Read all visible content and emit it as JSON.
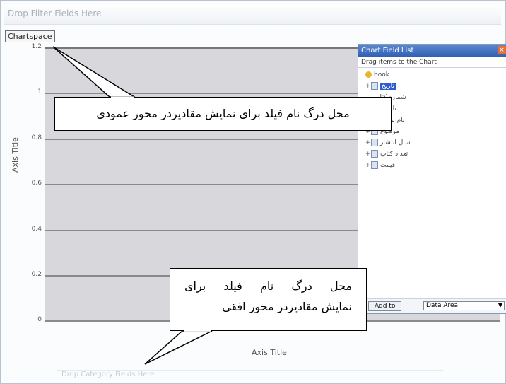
{
  "drop_banner": "Drop Filter Fields Here",
  "chartspace_label": "Chartspace",
  "chart_data": {
    "type": "bar",
    "categories": [],
    "series": [],
    "ylim": [
      0,
      1.2
    ],
    "yticks": [
      "1.2",
      "1",
      "0.8",
      "0.6",
      "0.4",
      "0.2",
      "0"
    ],
    "ylabel": "Axis Title",
    "xlabel": "Axis Title",
    "grid": true
  },
  "x_drop_zone": "Drop Category Fields Here",
  "field_list": {
    "title": "Chart Field List",
    "close": "×",
    "subtitle": "Drag items to the Chart",
    "items": [
      {
        "label": "book",
        "selected": false
      },
      {
        "label": "تاریخ",
        "selected": true
      },
      {
        "label": "شماره کتاب",
        "selected": false
      },
      {
        "label": "نام کتاب",
        "selected": false
      },
      {
        "label": "نام نویسنده",
        "selected": false
      },
      {
        "label": "موضوع",
        "selected": false
      },
      {
        "label": "سال انتشار",
        "selected": false
      },
      {
        "label": "تعداد کتاب",
        "selected": false
      },
      {
        "label": "قیمت",
        "selected": false
      }
    ],
    "add_button": "Add to",
    "area_select": "Data Area"
  },
  "callouts": {
    "vertical": "محل درگ نام فیلد برای نمایش مقادیردر محور عمودی",
    "horizontal_line1": "محل درگ نام فیلد برای",
    "horizontal_line2": "نمایش مقادیردر محور افقی"
  }
}
